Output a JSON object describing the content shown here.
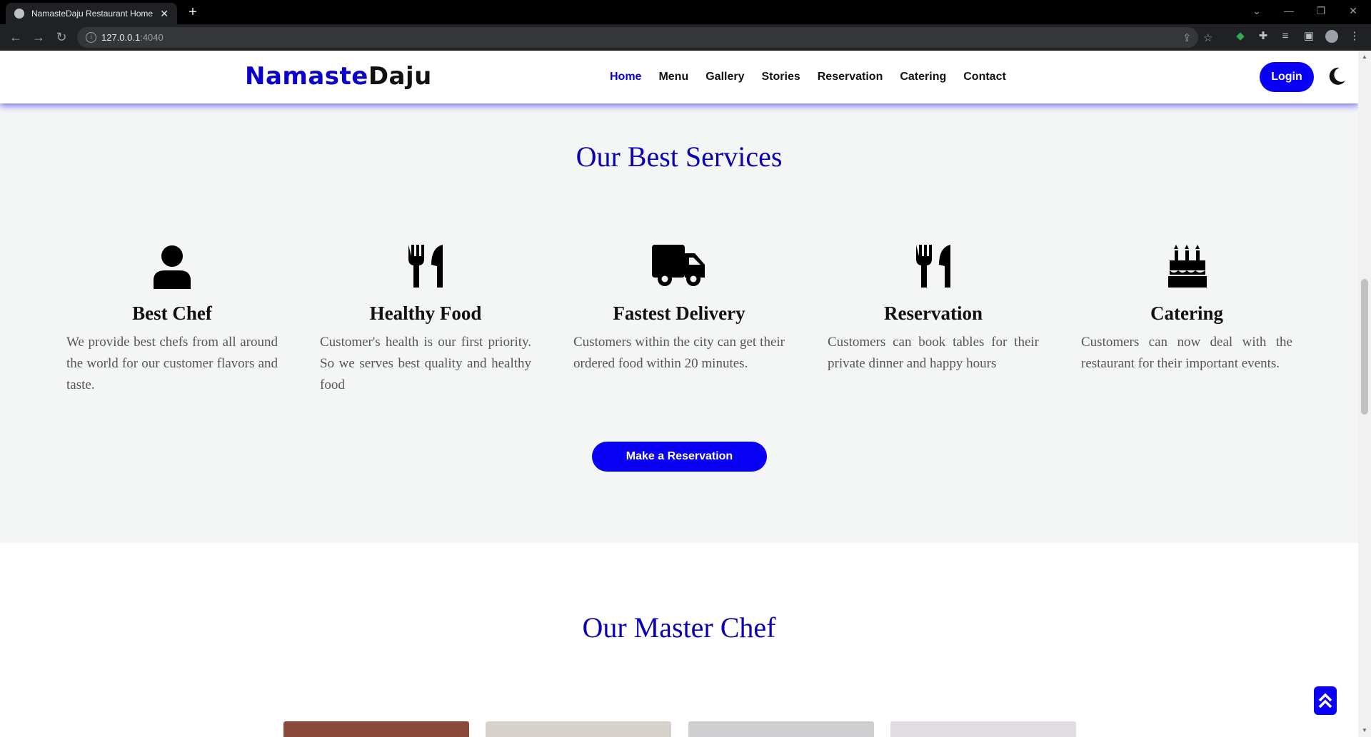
{
  "browser": {
    "tab_title": "NamasteDaju Restaurant Home",
    "tab_close": "✕",
    "new_tab": "+",
    "url_host": "127.0.0.1",
    "url_port": ":4040"
  },
  "site": {
    "logo_part1": "Namaste",
    "logo_part2": "Daju",
    "nav": [
      "Home",
      "Menu",
      "Gallery",
      "Stories",
      "Reservation",
      "Catering",
      "Contact"
    ],
    "active_nav": "Home",
    "login_label": "Login"
  },
  "services": {
    "title": "Our Best Services",
    "items": [
      {
        "icon": "user-icon",
        "title": "Best Chef",
        "text": "We provide best chefs from all around the world for our customer flavors and taste."
      },
      {
        "icon": "utensils-icon",
        "title": "Healthy Food",
        "text": "Customer's health is our first priority. So we serves best quality and healthy food"
      },
      {
        "icon": "truck-icon",
        "title": "Fastest Delivery",
        "text": "Customers within the city can get their ordered food within 20 minutes."
      },
      {
        "icon": "utensils-icon",
        "title": "Reservation",
        "text": "Customers can book tables for their private dinner and happy hours"
      },
      {
        "icon": "birthday-cake-icon",
        "title": "Catering",
        "text": "Customers can now deal with the restaurant for their important events."
      }
    ],
    "button_label": "Make a Reservation"
  },
  "chefs": {
    "title": "Our Master Chef"
  },
  "colors": {
    "brand_blue": "#0a00f5",
    "heading_blue": "#0b00b4"
  }
}
